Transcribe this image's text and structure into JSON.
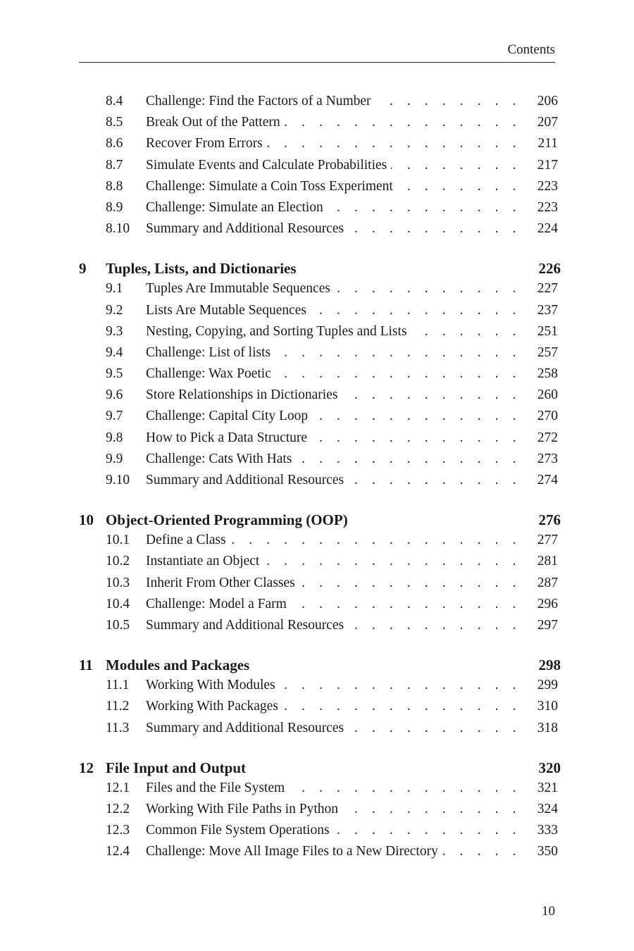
{
  "header": {
    "running_title": "Contents"
  },
  "toc": [
    {
      "number": "",
      "title": "",
      "page": "",
      "continued": true,
      "sections": [
        {
          "number": "8.4",
          "title": "Challenge: Find the Factors of a Number",
          "page": "206"
        },
        {
          "number": "8.5",
          "title": "Break Out of the Pattern",
          "page": "207"
        },
        {
          "number": "8.6",
          "title": "Recover From Errors",
          "page": "211"
        },
        {
          "number": "8.7",
          "title": "Simulate Events and Calculate Probabilities",
          "page": "217"
        },
        {
          "number": "8.8",
          "title": "Challenge: Simulate a Coin Toss Experiment",
          "page": "223"
        },
        {
          "number": "8.9",
          "title": "Challenge: Simulate an Election",
          "page": "223"
        },
        {
          "number": "8.10",
          "title": "Summary and Additional Resources",
          "page": "224"
        }
      ]
    },
    {
      "number": "9",
      "title": "Tuples, Lists, and Dictionaries",
      "page": "226",
      "sections": [
        {
          "number": "9.1",
          "title": "Tuples Are Immutable Sequences",
          "page": "227"
        },
        {
          "number": "9.2",
          "title": "Lists Are Mutable Sequences",
          "page": "237"
        },
        {
          "number": "9.3",
          "title": "Nesting, Copying, and Sorting Tuples and Lists",
          "page": "251"
        },
        {
          "number": "9.4",
          "title": "Challenge: List of lists",
          "page": "257"
        },
        {
          "number": "9.5",
          "title": "Challenge: Wax Poetic",
          "page": "258"
        },
        {
          "number": "9.6",
          "title": "Store Relationships in Dictionaries",
          "page": "260"
        },
        {
          "number": "9.7",
          "title": "Challenge: Capital City Loop",
          "page": "270"
        },
        {
          "number": "9.8",
          "title": "How to Pick a Data Structure",
          "page": "272"
        },
        {
          "number": "9.9",
          "title": "Challenge: Cats With Hats",
          "page": "273"
        },
        {
          "number": "9.10",
          "title": "Summary and Additional Resources",
          "page": "274"
        }
      ]
    },
    {
      "number": "10",
      "title": "Object-Oriented Programming (OOP)",
      "page": "276",
      "sections": [
        {
          "number": "10.1",
          "title": "Define a Class",
          "page": "277"
        },
        {
          "number": "10.2",
          "title": "Instantiate an Object",
          "page": "281"
        },
        {
          "number": "10.3",
          "title": "Inherit From Other Classes",
          "page": "287"
        },
        {
          "number": "10.4",
          "title": "Challenge: Model a Farm",
          "page": "296"
        },
        {
          "number": "10.5",
          "title": "Summary and Additional Resources",
          "page": "297"
        }
      ]
    },
    {
      "number": "11",
      "title": "Modules and Packages",
      "page": "298",
      "sections": [
        {
          "number": "11.1",
          "title": "Working With Modules",
          "page": "299"
        },
        {
          "number": "11.2",
          "title": "Working With Packages",
          "page": "310"
        },
        {
          "number": "11.3",
          "title": "Summary and Additional Resources",
          "page": "318"
        }
      ]
    },
    {
      "number": "12",
      "title": "File Input and Output",
      "page": "320",
      "sections": [
        {
          "number": "12.1",
          "title": "Files and the File System",
          "page": "321"
        },
        {
          "number": "12.2",
          "title": "Working With File Paths in Python",
          "page": "324"
        },
        {
          "number": "12.3",
          "title": "Common File System Operations",
          "page": "333"
        },
        {
          "number": "12.4",
          "title": "Challenge: Move All Image Files to a New Directory",
          "page": "350"
        }
      ]
    }
  ],
  "footer": {
    "page_number": "10"
  }
}
